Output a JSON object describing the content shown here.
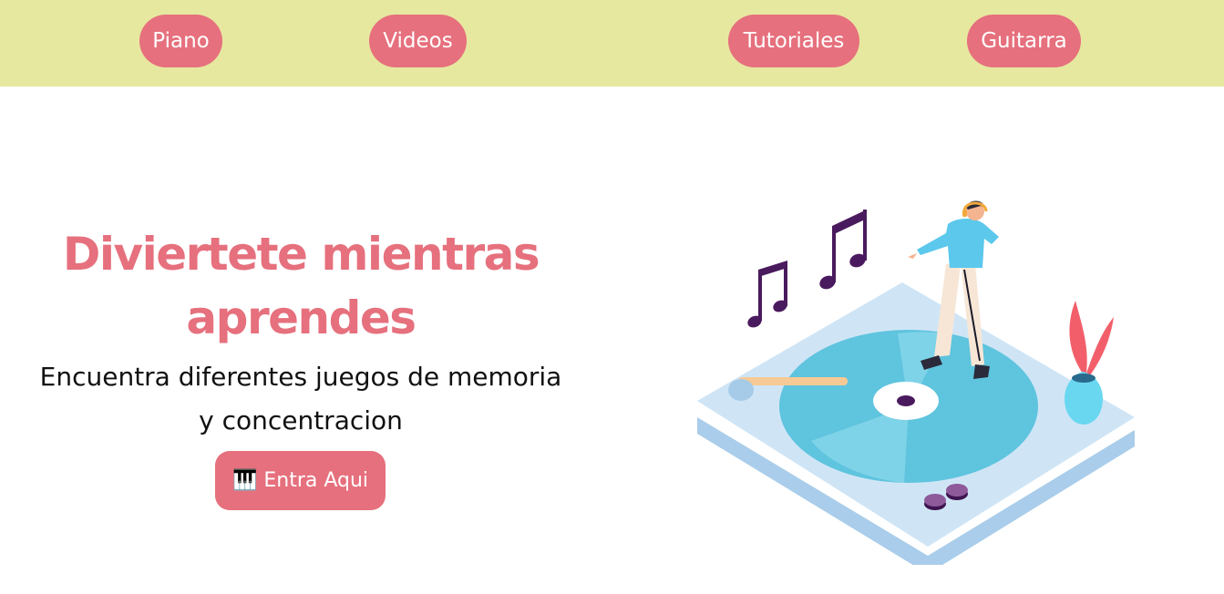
{
  "nav": {
    "items": [
      {
        "label": "Piano"
      },
      {
        "label": "Videos"
      },
      {
        "label": "Tutoriales"
      },
      {
        "label": "Guitarra"
      }
    ]
  },
  "hero": {
    "title": "Diviertete mientras aprendes",
    "subtitle": "Encuentra diferentes juegos de memoria y concentracion",
    "cta_label": "Entra Aqui",
    "cta_icon": "🎹"
  },
  "illustration": {
    "icon": "turntable-dancer-illustration"
  },
  "colors": {
    "topbar_bg": "#e7e8a0",
    "accent": "#e6707d",
    "text": "#111111"
  }
}
